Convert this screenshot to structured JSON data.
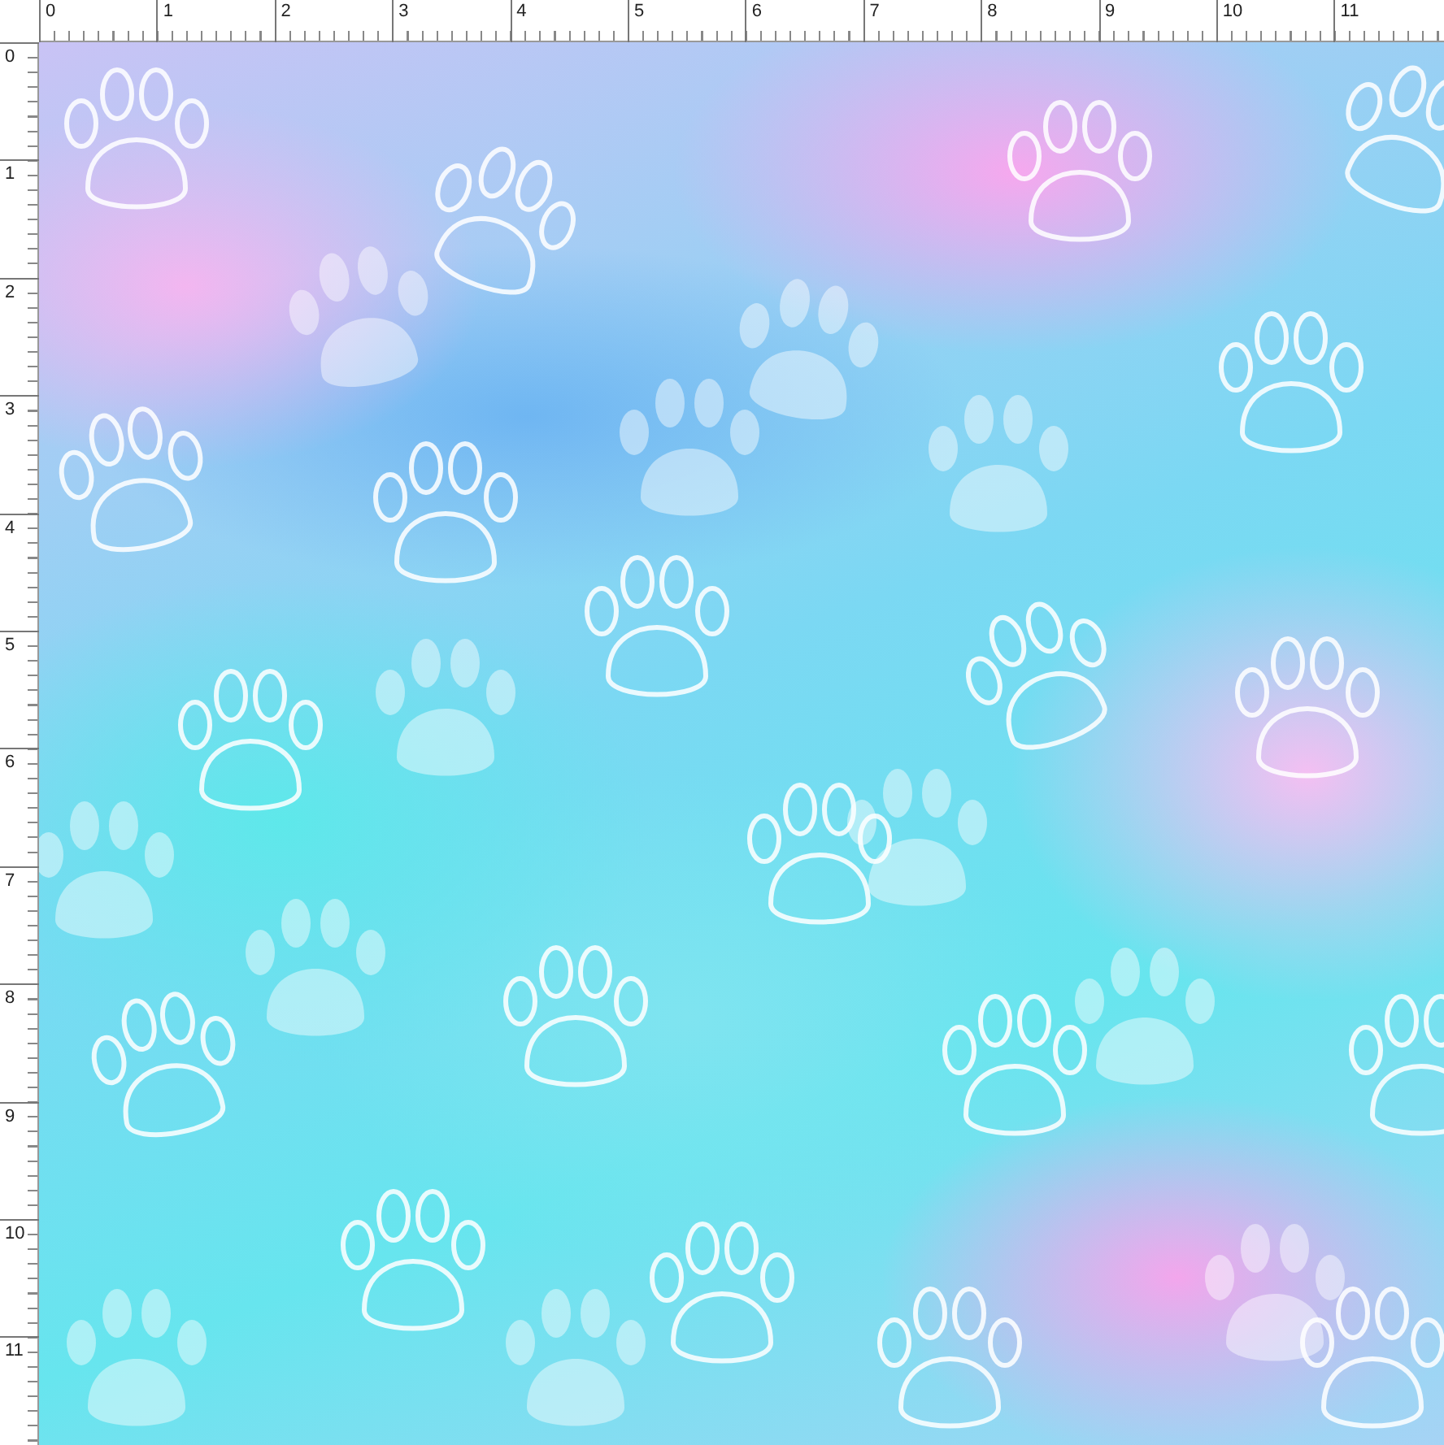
{
  "ruler_top": {
    "labels": [
      "0",
      "1",
      "2",
      "3",
      "4",
      "5",
      "6",
      "7",
      "8",
      "9",
      "10",
      "11"
    ]
  },
  "ruler_left": {
    "labels": [
      "0",
      "1",
      "2",
      "3",
      "4",
      "5",
      "6",
      "7",
      "8",
      "9",
      "10",
      "11"
    ]
  }
}
